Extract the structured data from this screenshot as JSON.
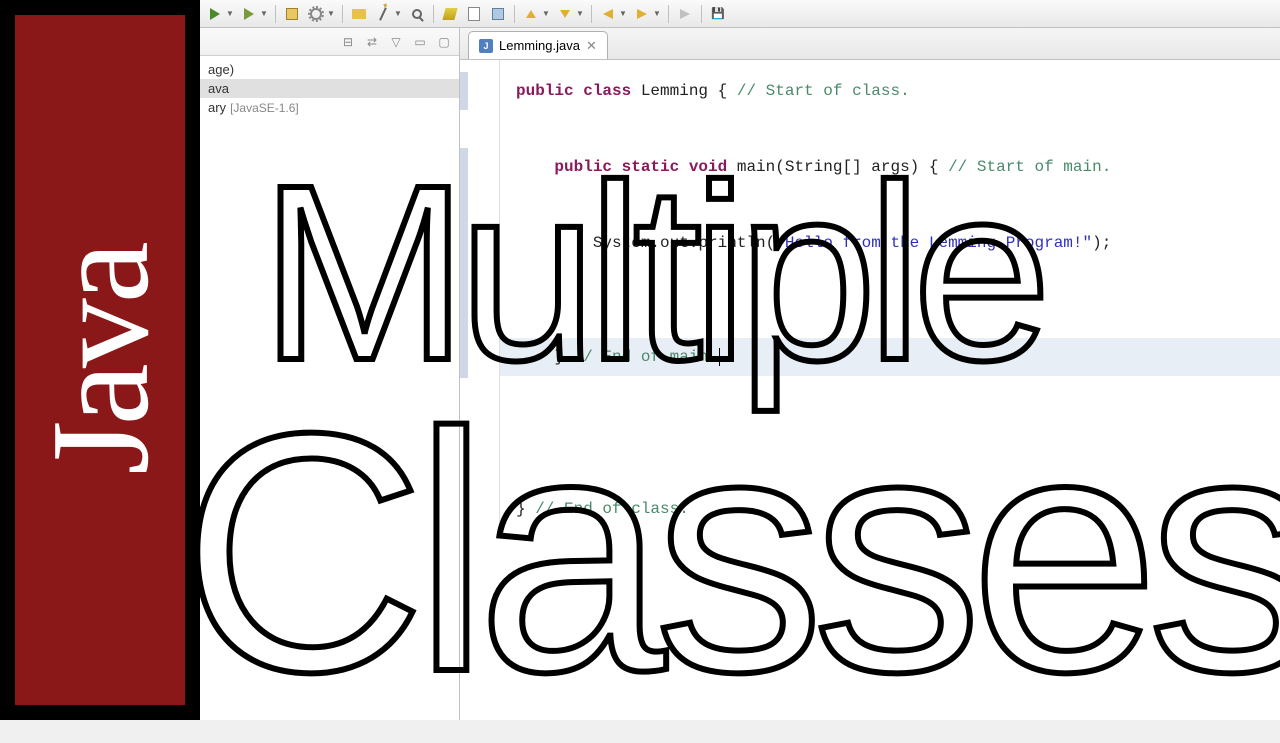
{
  "banner": {
    "label": "Java"
  },
  "overlay": {
    "line1": "Multiple",
    "line2": "Classes"
  },
  "toolbar": {
    "run": "Run",
    "debug": "Debug",
    "new": "New",
    "create": "Create",
    "open": "Open Type",
    "search": "Search",
    "format": "Format",
    "back": "Back",
    "forward": "Forward"
  },
  "explorer": {
    "items": [
      {
        "label": "age)",
        "type": "pkg"
      },
      {
        "label": "ava",
        "type": "file"
      },
      {
        "label": "ary",
        "lib": "[JavaSE-1.6]",
        "type": "lib"
      }
    ]
  },
  "editor": {
    "tab": {
      "name": "Lemming.java"
    },
    "code": {
      "l1_kw": "public class",
      "l1_name": " Lemming ",
      "l1_brace": "{ ",
      "l1_cm": "// Start of class.",
      "l3_kw": "public static void",
      "l3_name": " main",
      "l3_args": "(String[] args) { ",
      "l3_cm": "// Start of main.",
      "l5_call": "System.out.println(",
      "l5_str": "\"Hello from the Lemming Program!\"",
      "l5_end": ");",
      "l8_brace": "    } ",
      "l8_cm": "// End of main.",
      "l12_brace": "} ",
      "l12_cm": "// End of class."
    }
  }
}
